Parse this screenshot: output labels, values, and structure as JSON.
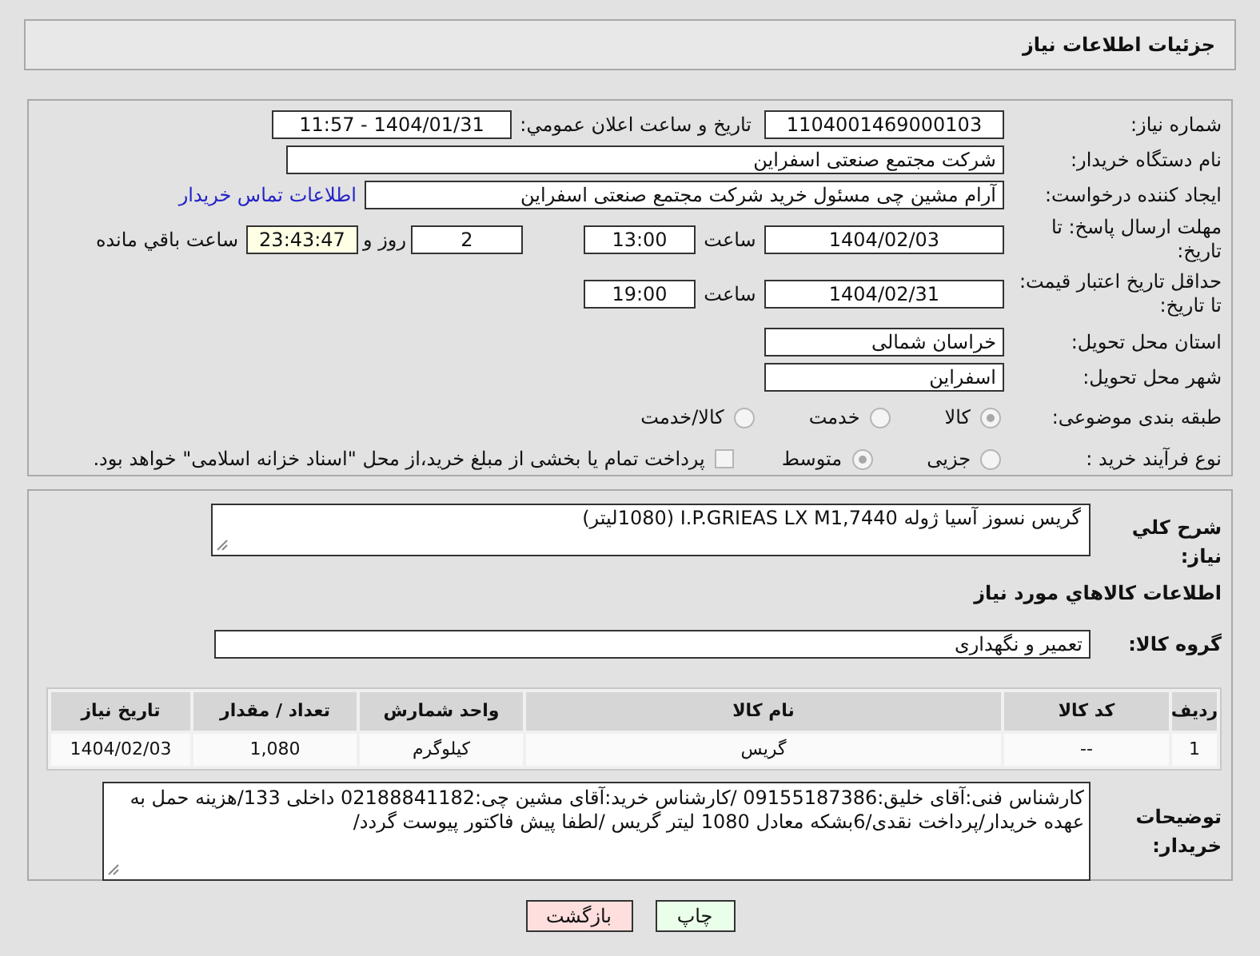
{
  "header": {
    "title": "جزئیات اطلاعات نیاز"
  },
  "need_number": {
    "label": "شماره نیاز:",
    "value": "1104001469000103"
  },
  "announce": {
    "label": "تاریخ و ساعت اعلان عمومي:",
    "value": "1404/01/31 - 11:57"
  },
  "buyer_org": {
    "label": "نام دستگاه خریدار:",
    "value": "شرکت مجتمع صنعتی اسفراین"
  },
  "requester": {
    "label": "ایجاد کننده درخواست:",
    "value": "آرام مشین چی مسئول خرید شرکت مجتمع صنعتی اسفراین",
    "link": "اطلاعات تماس خریدار"
  },
  "deadline": {
    "label": "مهلت ارسال پاسخ: تا تاریخ:",
    "date": "1404/02/03",
    "time_label": "ساعت",
    "time": "13:00",
    "days": "2",
    "days_label": "روز و",
    "remaining": "23:43:47",
    "remaining_label": "ساعت باقي مانده"
  },
  "price_validity": {
    "label": "حداقل تاریخ اعتبار قیمت: تا تاریخ:",
    "date": "1404/02/31",
    "time_label": "ساعت",
    "time": "19:00"
  },
  "province": {
    "label": "استان محل تحویل:",
    "value": "خراسان شمالی"
  },
  "city": {
    "label": "شهر محل تحویل:",
    "value": "اسفراین"
  },
  "category": {
    "label": "طبقه بندی موضوعی:",
    "options": [
      {
        "label": "کالا",
        "selected": true
      },
      {
        "label": "خدمت",
        "selected": false
      },
      {
        "label": "کالا/خدمت",
        "selected": false
      }
    ]
  },
  "process": {
    "label": "نوع فرآیند خرید :",
    "options": [
      {
        "label": "جزیی",
        "selected": false
      },
      {
        "label": "متوسط",
        "selected": true
      }
    ],
    "treasury": {
      "label": "پرداخت تمام یا بخشی از مبلغ خرید،از محل \"اسناد خزانه اسلامی\" خواهد بود.",
      "checked": false
    }
  },
  "description": {
    "label": "شرح کلي نياز:",
    "value": "گریس نسوز آسیا ژوله   I.P.GRIEAS LX M1,7440 (1080لیتر)"
  },
  "items_heading": "اطلاعات کالاهاي مورد نياز",
  "goods_group": {
    "label": "گروه کالا:",
    "value": "تعمیر و نگهداری"
  },
  "table": {
    "columns": [
      "ردیف",
      "کد کالا",
      "نام کالا",
      "واحد شمارش",
      "تعداد / مقدار",
      "تاریخ نیاز"
    ],
    "rows": [
      [
        "1",
        "--",
        "گریس",
        "کیلوگرم",
        "1,080",
        "1404/02/03"
      ]
    ]
  },
  "buyer_notes": {
    "label": "توضیحات خریدار:",
    "value": "کارشناس فنی:آقای خلیق:09155187386 /کارشناس خرید:آقای مشین چی:02188841182 داخلی 133/هزینه حمل به عهده خریدار/پرداخت نقدی/6بشکه معادل 1080 لیتر گریس /لطفا پیش فاکتور پیوست گردد/"
  },
  "buttons": [
    {
      "label": "چاپ",
      "kind": "print"
    },
    {
      "label": "بازگشت",
      "kind": "back"
    }
  ]
}
